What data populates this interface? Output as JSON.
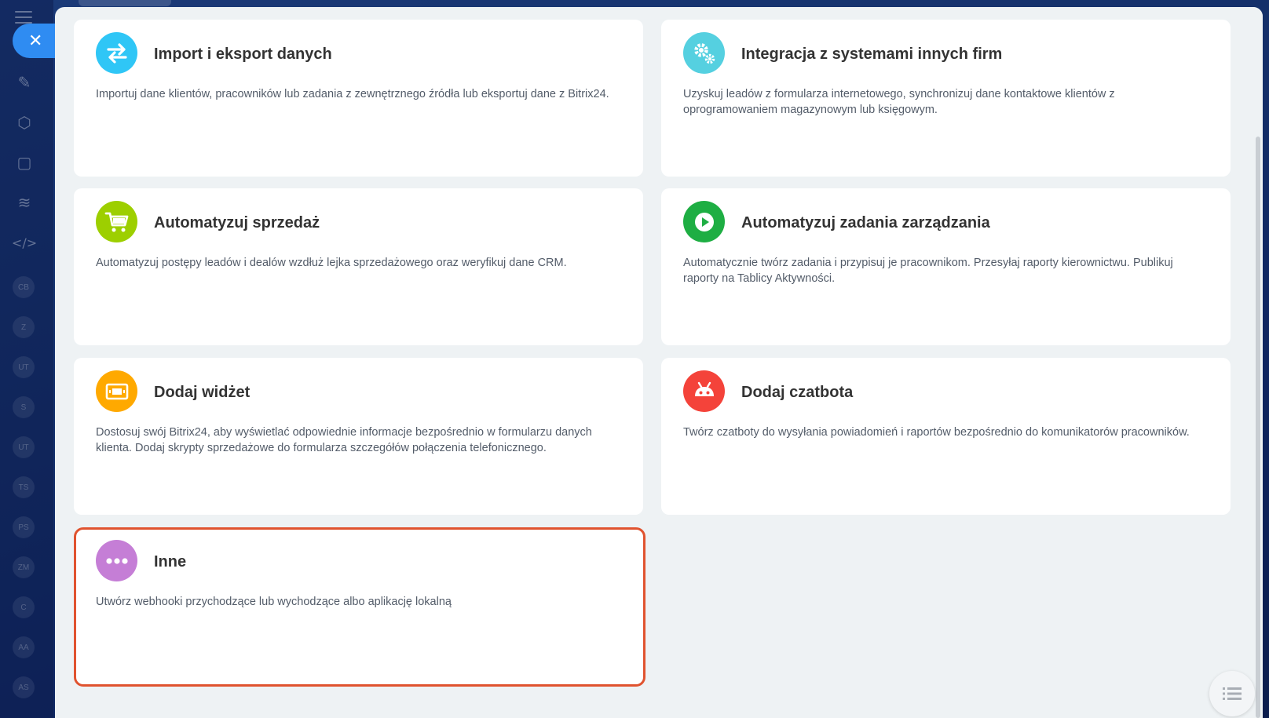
{
  "sidebar": {
    "close_glyph": "✕",
    "avatars": [
      "CB",
      "Z",
      "UT",
      "S",
      "UT",
      "TS",
      "PS",
      "ZM",
      "C",
      "AA",
      "AS"
    ]
  },
  "cards": [
    {
      "title": "Import i eksport danych",
      "desc": "Importuj dane klientów, pracowników lub zadania z zewnętrznego źródła lub eksportuj dane z Bitrix24.",
      "icon": "arrows-exchange-icon",
      "color": "#2fc6f6"
    },
    {
      "title": "Integracja z systemami innych firm",
      "desc": "Uzyskuj leadów z formularza internetowego, synchronizuj dane kontaktowe klientów z oprogramowaniem magazynowym lub księgowym.",
      "icon": "gears-icon",
      "color": "#55d0e0"
    },
    {
      "title": "Automatyzuj sprzedaż",
      "desc": "Automatyzuj postępy leadów i dealów wzdłuż lejka sprzedażowego oraz weryfikuj dane CRM.",
      "icon": "cart-icon",
      "color": "#9dcf00"
    },
    {
      "title": "Automatyzuj zadania zarządzania",
      "desc": "Automatycznie twórz zadania i przypisuj je pracownikom. Przesyłaj raporty kierownictwu. Publikuj raporty na Tablicy Aktywności.",
      "icon": "play-icon",
      "color": "#1eae43"
    },
    {
      "title": "Dodaj widżet",
      "desc": "Dostosuj swój Bitrix24, aby wyświetlać odpowiednie informacje bezpośrednio w formularzu danych klienta. Dodaj skrypty sprzedażowe do formularza szczegółów połączenia telefonicznego.",
      "icon": "widget-icon",
      "color": "#ffa900"
    },
    {
      "title": "Dodaj czatbota",
      "desc": "Twórz czatboty do wysyłania powiadomień i raportów bezpośrednio do komunikatorów pracowników.",
      "icon": "robot-icon",
      "color": "#f4433a"
    },
    {
      "title": "Inne",
      "desc": "Utwórz webhooki przychodzące lub wychodzące albo aplikację lokalną",
      "icon": "more-dots-icon",
      "color": "#c57ed6"
    }
  ]
}
